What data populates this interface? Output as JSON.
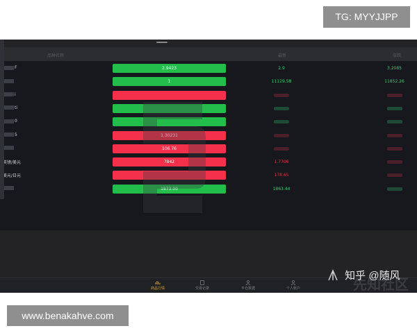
{
  "overlay": {
    "tg_label": "TG: MYYJJPP",
    "url_label": "www.benakahve.com",
    "zhihu_label": "知乎 @随风",
    "ghost_brand": "先知社区"
  },
  "table": {
    "headers": {
      "name": "品种名称",
      "price": "最新",
      "change": "涨跌"
    },
    "rows": [
      {
        "name": "F",
        "pill": "2.9423",
        "dir": "up",
        "price": "2.9",
        "change": "3.2085",
        "price_color": "green",
        "change_color": "green"
      },
      {
        "name": "",
        "pill": "1",
        "dir": "up",
        "price": "11129.58",
        "change": "11852.26",
        "price_color": "green",
        "change_color": "green"
      },
      {
        "name": "i",
        "pill": "",
        "dir": "down",
        "price": "",
        "change": "",
        "price_color": "red",
        "change_color": "red"
      },
      {
        "name": "ti",
        "pill": "",
        "dir": "up",
        "price": "",
        "change": "",
        "price_color": "green",
        "change_color": "green"
      },
      {
        "name": "0",
        "pill": "",
        "dir": "up",
        "price": "",
        "change": "",
        "price_color": "green",
        "change_color": "green"
      },
      {
        "name": "5",
        "pill": "1.30231",
        "dir": "down",
        "price": "",
        "change": "",
        "price_color": "red",
        "change_color": "red"
      },
      {
        "name": "",
        "pill": "106.76",
        "dir": "down",
        "price": "",
        "change": "",
        "price_color": "red",
        "change_color": "red"
      },
      {
        "name": "英镑/美元",
        "pill": "7842",
        "dir": "down",
        "price": "1.7706",
        "change": "",
        "price_color": "red",
        "change_color": "red"
      },
      {
        "name": "美元/日元",
        "pill": "",
        "dir": "down",
        "price": "178.65",
        "change": "",
        "price_color": "red",
        "change_color": "red"
      },
      {
        "name": "",
        "pill": "1873.00",
        "dir": "up",
        "price": "1863.44",
        "change": "",
        "price_color": "green",
        "change_color": "green"
      }
    ]
  },
  "tabs": [
    {
      "label": "商品行情",
      "icon": "chart-icon",
      "active": true
    },
    {
      "label": "交易记录",
      "icon": "document-icon",
      "active": false
    },
    {
      "label": "平仓数据",
      "icon": "user-icon",
      "active": false
    },
    {
      "label": "个人账户",
      "icon": "account-icon",
      "active": false
    }
  ],
  "colors": {
    "up": "#22bd4a",
    "down": "#f5304a",
    "active_tab": "#d4a23c"
  }
}
